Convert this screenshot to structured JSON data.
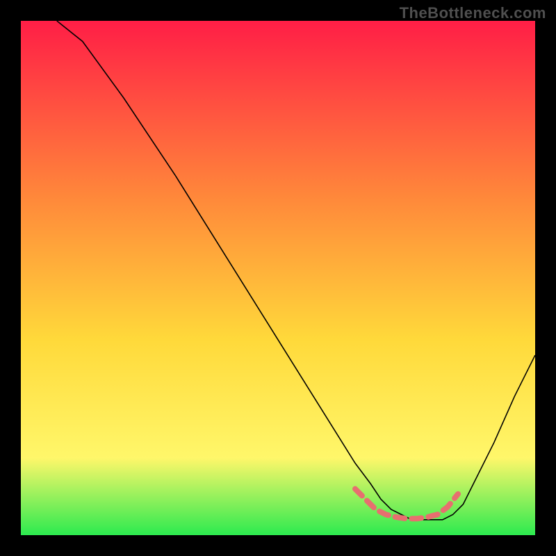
{
  "watermark": "TheBottleneck.com",
  "chart_data": {
    "type": "line",
    "title": "",
    "xlabel": "",
    "ylabel": "",
    "xlim": [
      0,
      100
    ],
    "ylim": [
      0,
      100
    ],
    "grid": false,
    "series": [
      {
        "name": "bottleneck-curve",
        "x": [
          7,
          12,
          20,
          30,
          40,
          50,
          60,
          65,
          68,
          70,
          72,
          74,
          76,
          78,
          80,
          82,
          84,
          86,
          88,
          92,
          96,
          100
        ],
        "y": [
          100,
          96,
          85,
          70,
          54,
          38,
          22,
          14,
          10,
          7,
          5,
          4,
          3,
          3,
          3,
          3,
          4,
          6,
          10,
          18,
          27,
          35
        ],
        "stroke": "#000000",
        "stroke_width": 1.6
      }
    ],
    "highlight_band": {
      "name": "optimal-zone",
      "x": [
        65,
        67,
        69,
        71,
        73,
        75,
        77,
        79,
        81,
        83,
        85
      ],
      "y": [
        9,
        7,
        5,
        4,
        3.5,
        3.2,
        3.2,
        3.5,
        4,
        5.5,
        8
      ],
      "stroke": "#e76f6f",
      "stroke_width": 8
    },
    "background_gradient": {
      "top": "#ff1e46",
      "mid1": "#ff8a3a",
      "mid2": "#ffd93a",
      "mid3": "#fff76a",
      "bottom": "#2cea4f"
    }
  }
}
